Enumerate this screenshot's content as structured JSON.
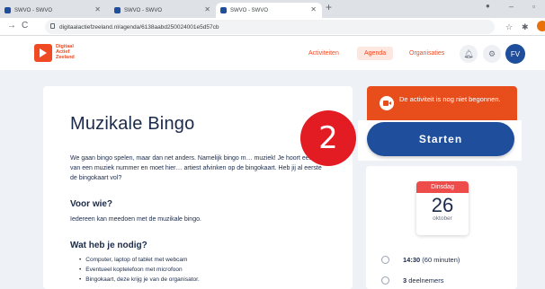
{
  "browser": {
    "tabs": [
      {
        "label": "SWVO - SWVO"
      },
      {
        "label": "SWVO - SWVO"
      },
      {
        "label": "SWVO - SWVO"
      }
    ],
    "url": "digitaalactiefzeeland.nl/agenda/6138aabd250024001e5d57cb"
  },
  "site": {
    "logo": {
      "line1": "Digitaal",
      "line2": "Actief",
      "line3": "Zeeland"
    },
    "nav": {
      "activiteiten": "Activiteiten",
      "agenda": "Agenda",
      "organisaties": "Organisaties"
    },
    "avatar_initials": "FV"
  },
  "activity": {
    "title": "Muzikale Bingo",
    "description": "We gaan bingo spelen, maar dan net anders. Namelijk bingo m… muziek! Je hoort een stuk van een muziek nummer en moet hier… artiest afvinken op de bingokaart. Heb jij al eerste de bingokaart vol?",
    "who_heading": "Voor wie?",
    "who_text": "Iedereen kan meedoen met de muzikale bingo.",
    "need_heading": "Wat heb je nodig?",
    "need_items": [
      "Computer, laptop of tablet met webcam",
      "Eventueel koptelefoon met microfoon",
      "Bingokaart, deze krijg je van de organisator."
    ]
  },
  "status": {
    "alert_text": "De activiteit is nog niet begonnen.",
    "start_label": "Starten",
    "step_number": "2"
  },
  "date": {
    "weekday": "Dinsdag",
    "day": "26",
    "month": "oktober"
  },
  "details": {
    "time": "14:30",
    "duration": "(60 minuten)",
    "participants_count": "3",
    "participants_label": "deelnemers"
  },
  "colors": {
    "brand_orange": "#ef4a23",
    "primary_blue": "#1f4e9c",
    "badge_red": "#e31b23",
    "calendar_red": "#ee4b4b"
  }
}
